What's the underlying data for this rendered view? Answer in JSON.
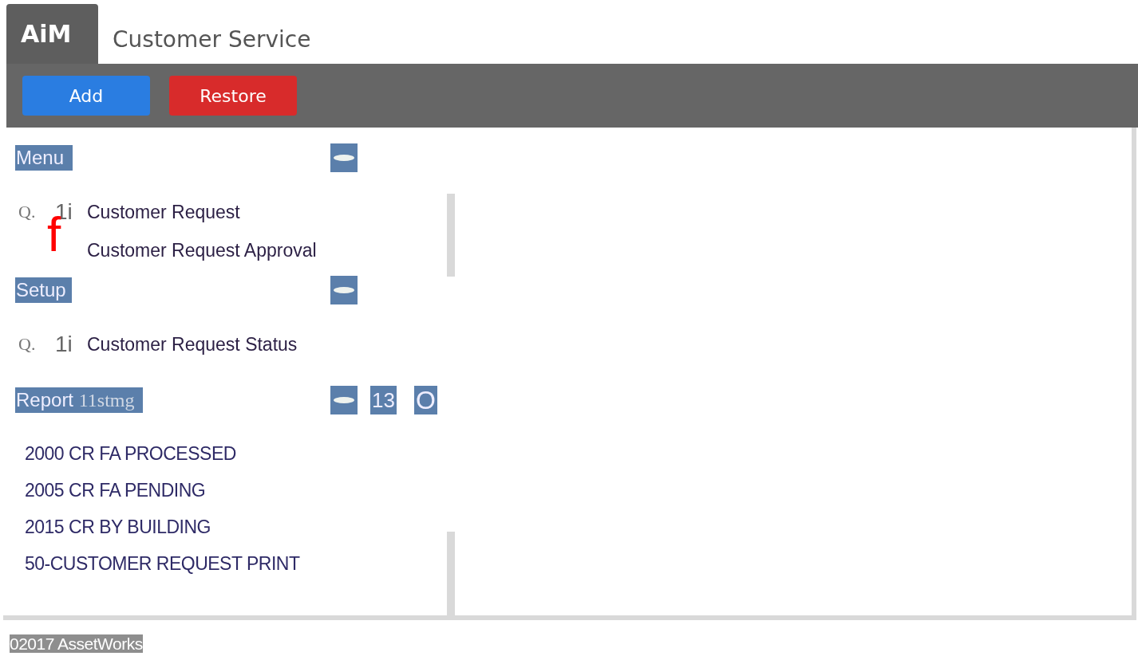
{
  "header": {
    "logo": "AiM",
    "title": "Customer Service"
  },
  "toolbar": {
    "buttons": [
      {
        "label": "Add",
        "kind": "primary"
      },
      {
        "label": "Restore",
        "kind": "danger"
      }
    ]
  },
  "sections": [
    {
      "title": "Menu",
      "items": [
        {
          "label": "Customer Request",
          "glyphs": [
            {
              "text": "Q.",
              "kind": "search"
            },
            {
              "text": "1i",
              "kind": "info"
            }
          ]
        },
        {
          "label": "Customer Request Approval",
          "glyphs": [
            {
              "text": "f",
              "kind": "flag"
            }
          ]
        }
      ]
    },
    {
      "title": "Setup",
      "items": [
        {
          "label": "Customer Request Status",
          "glyphs": [
            {
              "text": "Q.",
              "kind": "search"
            },
            {
              "text": "1i",
              "kind": "info"
            }
          ]
        }
      ]
    },
    {
      "title": "Report",
      "title_suffix": "11stmg",
      "extra_buttons": [
        "13",
        "O"
      ],
      "items": [
        {
          "label": "2000 CR FA PROCESSED"
        },
        {
          "label": "2005 CR FA PENDING"
        },
        {
          "label": "2015 CR BY BUILDING"
        },
        {
          "label": "50-CUSTOMER REQUEST PRINT"
        }
      ]
    }
  ],
  "footer": {
    "copyright": "02017 AssetWorks"
  }
}
